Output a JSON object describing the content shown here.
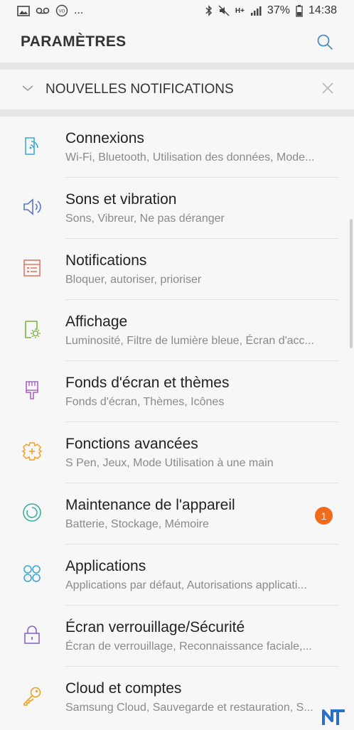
{
  "status_bar": {
    "left_icons": [
      "gallery-icon",
      "voicemail-icon",
      "volte-icon",
      "more-notifications-icon"
    ],
    "more": "...",
    "network": "H+",
    "battery": "37%",
    "time": "14:38",
    "right_icons": [
      "bluetooth-icon",
      "mute-icon",
      "network-icon",
      "signal-icon",
      "battery-icon"
    ]
  },
  "header": {
    "title": "PARAMÈTRES",
    "search_icon": "search-icon"
  },
  "notifications_bar": {
    "title": "NOUVELLES NOTIFICATIONS",
    "expand_icon": "chevron-down-icon",
    "close_icon": "close-icon"
  },
  "accent_color": "#4a8fc4",
  "badge_color": "#f26a1b",
  "settings": [
    {
      "title": "Connexions",
      "subtitle": "Wi-Fi, Bluetooth, Utilisation des données, Mode...",
      "icon": "connections-icon",
      "color": "#3fa9d6"
    },
    {
      "title": "Sons et vibration",
      "subtitle": "Sons, Vibreur, Ne pas déranger",
      "icon": "volume-icon",
      "color": "#5b74c9"
    },
    {
      "title": "Notifications",
      "subtitle": "Bloquer, autoriser, prioriser",
      "icon": "notifications-icon",
      "color": "#e57865"
    },
    {
      "title": "Affichage",
      "subtitle": "Luminosité, Filtre de lumière bleue, Écran d'acc...",
      "icon": "display-icon",
      "color": "#7cb342"
    },
    {
      "title": "Fonds d'écran et thèmes",
      "subtitle": "Fonds d'écran, Thèmes, Icônes",
      "icon": "brush-icon",
      "color": "#ab63c2"
    },
    {
      "title": "Fonctions avancées",
      "subtitle": "S Pen, Jeux, Mode Utilisation à une main",
      "icon": "advanced-features-icon",
      "color": "#f0a020"
    },
    {
      "title": "Maintenance de l'appareil",
      "subtitle": "Batterie, Stockage, Mémoire",
      "icon": "maintenance-icon",
      "color": "#3bb0a0",
      "badge": "1"
    },
    {
      "title": "Applications",
      "subtitle": "Applications par défaut, Autorisations applicati...",
      "icon": "apps-icon",
      "color": "#3fa9d6"
    },
    {
      "title": "Écran verrouillage/Sécurité",
      "subtitle": "Écran de verrouillage, Reconnaissance faciale,...",
      "icon": "lock-icon",
      "color": "#8a67c2"
    },
    {
      "title": "Cloud et comptes",
      "subtitle": "Samsung Cloud, Sauvegarde et restauration, S...",
      "icon": "key-icon",
      "color": "#f0a020"
    }
  ]
}
